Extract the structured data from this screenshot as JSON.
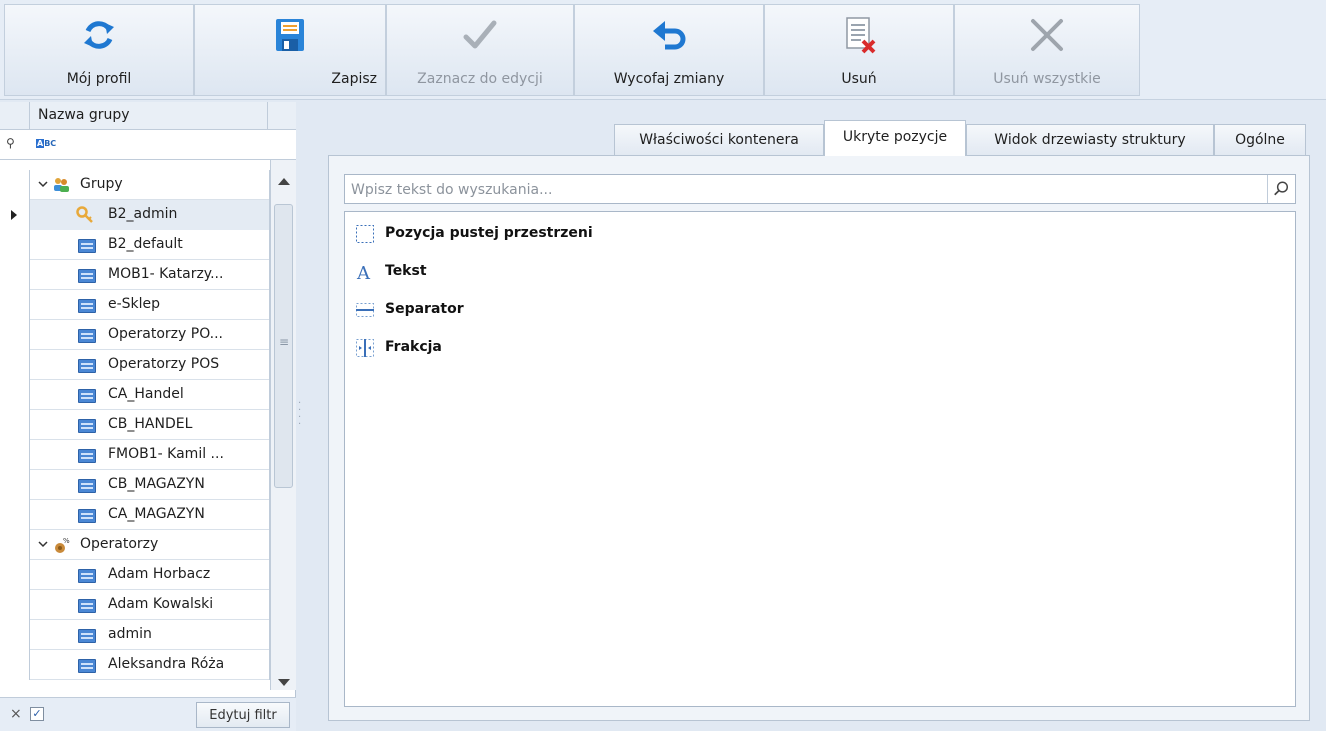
{
  "toolbar": {
    "buttons": [
      {
        "label": "Mój profil",
        "icon": "refresh-icon",
        "enabled": true
      },
      {
        "label": "Zapisz",
        "icon": "save-icon",
        "enabled": true
      },
      {
        "label": "Zaznacz do edycji",
        "icon": "checkmark-icon",
        "enabled": false
      },
      {
        "label": "Wycofaj zmiany",
        "icon": "undo-icon",
        "enabled": true
      },
      {
        "label": "Usuń",
        "icon": "delete-document-icon",
        "enabled": true
      },
      {
        "label": "Usuń wszystkie",
        "icon": "close-x-icon",
        "enabled": false
      }
    ]
  },
  "left_panel": {
    "column_header": "Nazwa grupy",
    "filter_icon": "abc-filter-icon",
    "tree": [
      {
        "label": "Grupy",
        "type": "group",
        "icon": "users-group-icon",
        "expanded": true
      },
      {
        "label": "B2_admin",
        "type": "leaf",
        "icon": "key-icon",
        "selected": true
      },
      {
        "label": "B2_default",
        "type": "leaf",
        "icon": "list-icon"
      },
      {
        "label": "MOB1- Katarzy...",
        "type": "leaf",
        "icon": "list-icon"
      },
      {
        "label": "e-Sklep",
        "type": "leaf",
        "icon": "list-icon"
      },
      {
        "label": "Operatorzy PO...",
        "type": "leaf",
        "icon": "list-icon"
      },
      {
        "label": "Operatorzy POS",
        "type": "leaf",
        "icon": "list-icon"
      },
      {
        "label": "CA_Handel",
        "type": "leaf",
        "icon": "list-icon"
      },
      {
        "label": "CB_HANDEL",
        "type": "leaf",
        "icon": "list-icon"
      },
      {
        "label": "FMOB1- Kamil ...",
        "type": "leaf",
        "icon": "list-icon"
      },
      {
        "label": "CB_MAGAZYN",
        "type": "leaf",
        "icon": "list-icon"
      },
      {
        "label": "CA_MAGAZYN",
        "type": "leaf",
        "icon": "list-icon"
      },
      {
        "label": "Operatorzy",
        "type": "group",
        "icon": "operators-icon",
        "expanded": true
      },
      {
        "label": "Adam Horbacz",
        "type": "leaf",
        "icon": "list-icon"
      },
      {
        "label": "Adam Kowalski",
        "type": "leaf",
        "icon": "list-icon"
      },
      {
        "label": "admin",
        "type": "leaf",
        "icon": "list-icon"
      },
      {
        "label": "Aleksandra Róża",
        "type": "leaf",
        "icon": "list-icon"
      }
    ],
    "footer": {
      "clear_symbol": "×",
      "check_symbol": "✓",
      "edit_filter_label": "Edytuj filtr"
    }
  },
  "tabs": [
    {
      "label": "Właściwości kontenera",
      "active": false
    },
    {
      "label": "Ukryte pozycje",
      "active": true
    },
    {
      "label": "Widok drzewiasty struktury",
      "active": false
    },
    {
      "label": "Ogólne",
      "active": false
    }
  ],
  "search": {
    "placeholder": "Wpisz tekst do wyszukania..."
  },
  "hidden_items": [
    {
      "label": "Pozycja pustej przestrzeni",
      "icon": "empty-space-icon"
    },
    {
      "label": "Tekst",
      "icon": "text-icon"
    },
    {
      "label": "Separator",
      "icon": "separator-icon"
    },
    {
      "label": "Frakcja",
      "icon": "fraction-icon"
    }
  ],
  "colors": {
    "accent": "#2a6fcf",
    "selection": "#e4ebf3",
    "background": "#e1e9f3"
  }
}
